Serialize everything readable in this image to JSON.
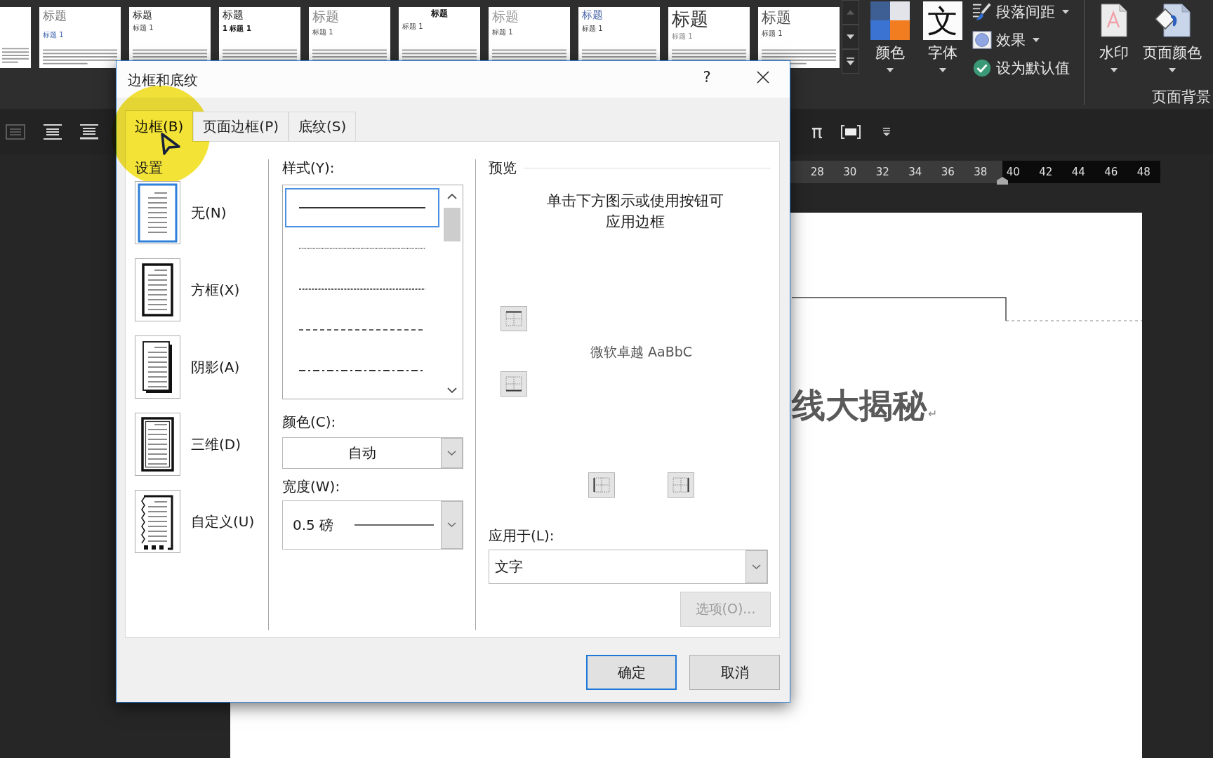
{
  "ribbon": {
    "style_gallery": [
      {
        "kind": "cropped"
      },
      {
        "kind": "titled",
        "heading": "标题",
        "subheading": "标题 1"
      },
      {
        "kind": "titled",
        "heading": "标题",
        "subheading": "标题 1"
      },
      {
        "kind": "titled",
        "heading": "标题",
        "subheading": "1 标题 1"
      },
      {
        "kind": "titled",
        "heading": "标题",
        "subheading": "标题 1"
      },
      {
        "kind": "titled",
        "heading": "标题",
        "subheading": "标题 1"
      },
      {
        "kind": "titled",
        "heading": "标题",
        "subheading": "标题 1"
      },
      {
        "kind": "titled",
        "heading": "标题",
        "subheading": "标题 1"
      },
      {
        "kind": "titled",
        "heading": "标题",
        "subheading": "标题 1"
      },
      {
        "kind": "titled",
        "heading": "标题",
        "subheading": "标题 1"
      }
    ],
    "theme_buttons": [
      {
        "kind": "colors",
        "label": "颜色"
      },
      {
        "kind": "fonts",
        "label": "字体",
        "glyph": "文"
      }
    ],
    "design_commands": [
      {
        "kind": "paragraph-spacing",
        "label": "段落间距",
        "dropdown": true
      },
      {
        "kind": "effects",
        "label": "效果",
        "dropdown": true
      },
      {
        "kind": "set-default",
        "label": "设为默认值",
        "dropdown": false
      }
    ],
    "page_background": {
      "buttons": [
        {
          "kind": "watermark",
          "label": "水印"
        },
        {
          "kind": "page-color",
          "label": "页面颜色"
        }
      ],
      "group_label": "页面背景"
    }
  },
  "toolbar": {
    "symbol": "π"
  },
  "ruler": {
    "numbers": [
      "28",
      "30",
      "32",
      "34",
      "36",
      "38",
      "40",
      "42",
      "44",
      "46",
      "48"
    ]
  },
  "document": {
    "heading": "线大揭秘",
    "paragraph_mark": "↵"
  },
  "dialog": {
    "title": "边框和底纹",
    "help": "?",
    "tabs": [
      {
        "label": "边框(B)",
        "selected": true
      },
      {
        "label": "页面边框(P)",
        "selected": false
      },
      {
        "label": "底纹(S)",
        "selected": false
      }
    ],
    "setting": {
      "label": "设置",
      "options": [
        {
          "kind": "none",
          "label": "无(N)",
          "selected": true
        },
        {
          "kind": "box",
          "label": "方框(X)",
          "selected": false
        },
        {
          "kind": "shadow",
          "label": "阴影(A)",
          "selected": false
        },
        {
          "kind": "relief",
          "label": "三维(D)",
          "selected": false
        },
        {
          "kind": "custom",
          "label": "自定义(U)",
          "selected": false
        }
      ]
    },
    "style": {
      "label": "样式(Y):",
      "options": [
        {
          "kind": "solid",
          "selected": true
        },
        {
          "kind": "dotted",
          "selected": false
        },
        {
          "kind": "finedashed",
          "selected": false
        },
        {
          "kind": "dashed",
          "selected": false
        },
        {
          "kind": "dashdot",
          "selected": false
        }
      ]
    },
    "color": {
      "label": "颜色(C):",
      "value": "自动"
    },
    "width": {
      "label": "宽度(W):",
      "value": "0.5 磅"
    },
    "preview": {
      "label": "预览",
      "hint": "单击下方图示或使用按钮可应用边框",
      "sample": "微软卓越 AaBbC"
    },
    "apply_to": {
      "label": "应用于(L):",
      "value": "文字"
    },
    "options_button": {
      "label": "选项(O)...",
      "disabled": true
    },
    "buttons": [
      {
        "label": "确定",
        "default": true
      },
      {
        "label": "取消",
        "default": false
      }
    ]
  }
}
